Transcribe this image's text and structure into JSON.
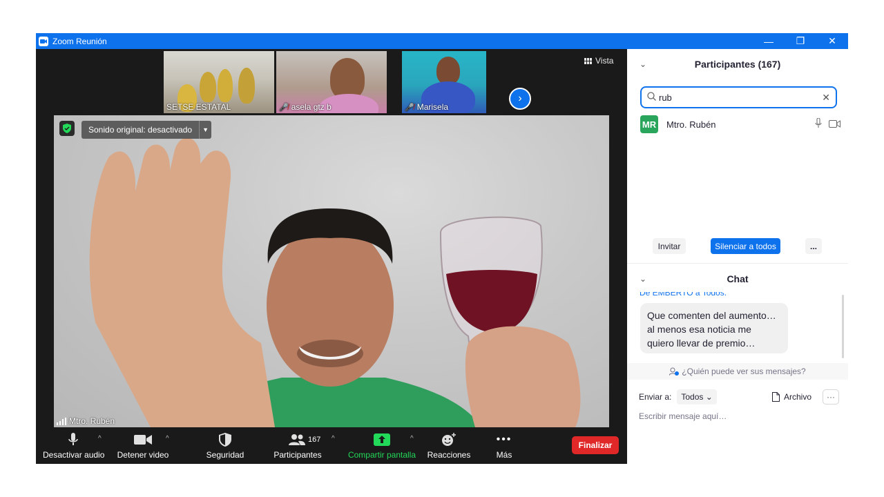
{
  "window": {
    "title": "Zoom Reunión",
    "controls": {
      "minimize": "—",
      "restore": "❐",
      "close": "✕"
    }
  },
  "gallery": {
    "thumbnails": [
      {
        "name": "SETSE ESTATAL",
        "muted": false
      },
      {
        "name": "asela gtz b",
        "muted": true
      },
      {
        "name": "Marisela",
        "muted": true
      }
    ],
    "next_icon": "›",
    "view_label": "Vista"
  },
  "main_video": {
    "sound_original": "Sonido original: desactivado",
    "speaker": "Mtro. Rubén"
  },
  "toolbar": {
    "audio_label": "Desactivar audio",
    "video_label": "Detener video",
    "security_label": "Seguridad",
    "participants_label": "Participantes",
    "participants_count": "167",
    "share_label": "Compartir pantalla",
    "reactions_label": "Reacciones",
    "more_label": "Más",
    "end_label": "Finalizar",
    "share_color": "#23d959",
    "end_color": "#e02828"
  },
  "participants_panel": {
    "title": "Participantes (167)",
    "search_value": "rub",
    "results": [
      {
        "initials": "MR",
        "name": "Mtro. Rubén",
        "avatar_color": "#29a55c"
      }
    ],
    "invite_label": "Invitar",
    "mute_all_label": "Silenciar a todos",
    "more_label": "..."
  },
  "chat": {
    "title": "Chat",
    "partial_header": "De EMBERTO a Todos:",
    "message_lines": [
      "Que comenten del aumento…",
      "al menos esa noticia me",
      "quiero llevar de premio…"
    ],
    "who_sees": "¿Quién puede ver sus mensajes?",
    "send_to_label": "Enviar a:",
    "send_to_value": "Todos",
    "file_label": "Archivo",
    "file_more": "···",
    "input_placeholder": "Escribir mensaje aquí…"
  }
}
